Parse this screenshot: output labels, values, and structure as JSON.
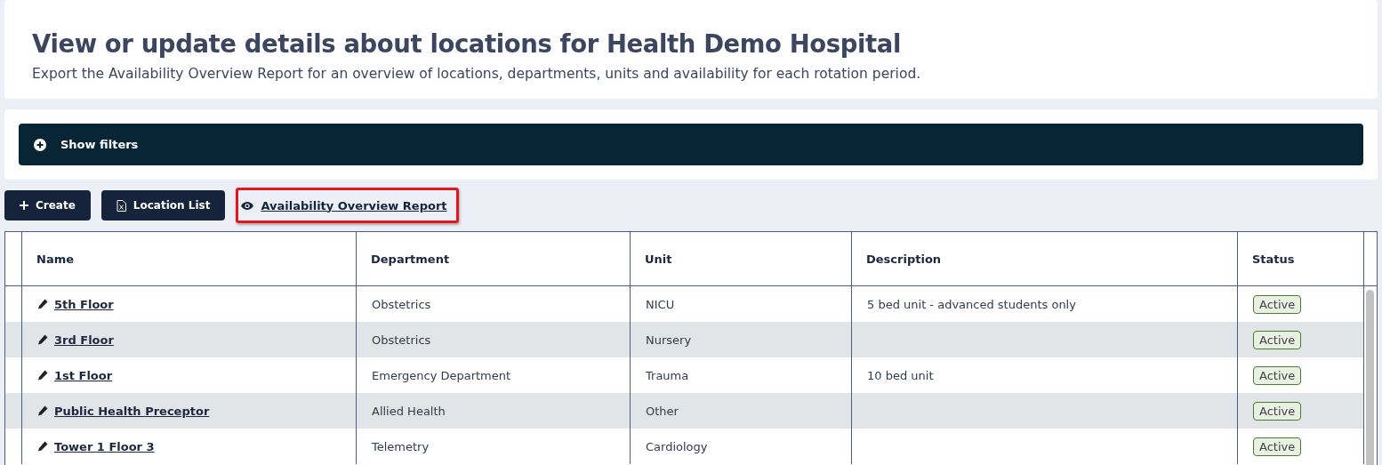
{
  "header": {
    "title": "View or update details about locations for Health Demo Hospital",
    "subtitle": "Export the Availability Overview Report for an overview of locations, departments, units and availability for each rotation period."
  },
  "filters": {
    "label": "Show filters",
    "expanded": false
  },
  "toolbar": [
    {
      "kind": "button",
      "label": "Create",
      "highlighted": false
    },
    {
      "kind": "button",
      "label": "Location List",
      "highlighted": false
    },
    {
      "kind": "link",
      "label": "Availability Overview Report",
      "highlighted": true
    }
  ],
  "table": {
    "columns": [
      "Name",
      "Department",
      "Unit",
      "Description",
      "Status"
    ],
    "rows": [
      {
        "name": "5th Floor",
        "department": "Obstetrics",
        "unit": "NICU",
        "description": "5 bed unit - advanced students only",
        "status": "Active"
      },
      {
        "name": "3rd Floor",
        "department": "Obstetrics",
        "unit": "Nursery",
        "description": "",
        "status": "Active"
      },
      {
        "name": "1st Floor",
        "department": "Emergency Department",
        "unit": "Trauma",
        "description": "10 bed unit",
        "status": "Active"
      },
      {
        "name": "Public Health Preceptor",
        "department": "Allied Health",
        "unit": "Other",
        "description": "",
        "status": "Active"
      },
      {
        "name": "Tower 1 Floor 3",
        "department": "Telemetry",
        "unit": "Cardiology",
        "description": "",
        "status": "Active"
      }
    ]
  }
}
